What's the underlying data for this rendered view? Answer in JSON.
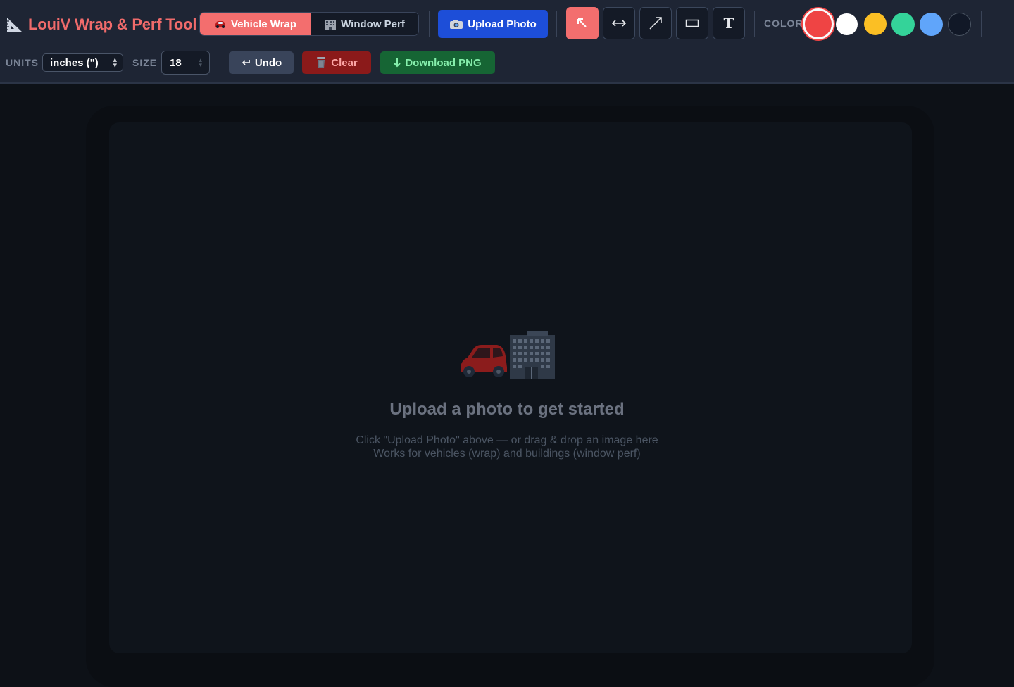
{
  "app": {
    "title": "LouiV Wrap & Perf Tool",
    "title_icon": "triangle-ruler-icon"
  },
  "mode_tabs": [
    {
      "label": "Vehicle Wrap",
      "icon": "car-icon",
      "active": true
    },
    {
      "label": "Window Perf",
      "icon": "building-icon",
      "active": false
    }
  ],
  "upload": {
    "label": "Upload Photo",
    "icon": "camera-icon"
  },
  "tools": [
    {
      "name": "select",
      "icon": "pointer-arrow-icon",
      "active": true
    },
    {
      "name": "measure",
      "icon": "double-arrow-icon",
      "active": false
    },
    {
      "name": "arrow",
      "icon": "diagonal-arrow-icon",
      "active": false
    },
    {
      "name": "rectangle",
      "icon": "rectangle-icon",
      "active": false
    },
    {
      "name": "text",
      "icon": "text-icon",
      "glyph": "T",
      "active": false
    }
  ],
  "color": {
    "label": "COLOR",
    "swatches": [
      "#ef4444",
      "#ffffff",
      "#fbbf24",
      "#34d399",
      "#60a5fa",
      "#111827"
    ],
    "selected": "#ef4444"
  },
  "units": {
    "label": "UNITS",
    "value": "inches (\")"
  },
  "size": {
    "label": "SIZE",
    "value": "18"
  },
  "actions": {
    "undo": "Undo",
    "clear": "Clear",
    "download": "Download PNG"
  },
  "placeholder": {
    "icons": [
      "car-icon",
      "building-icon"
    ],
    "title": "Upload a photo to get started",
    "line1": "Click \"Upload Photo\" above — or drag & drop an image here",
    "line2": "Works for vehicles (wrap) and buildings (window perf)"
  }
}
